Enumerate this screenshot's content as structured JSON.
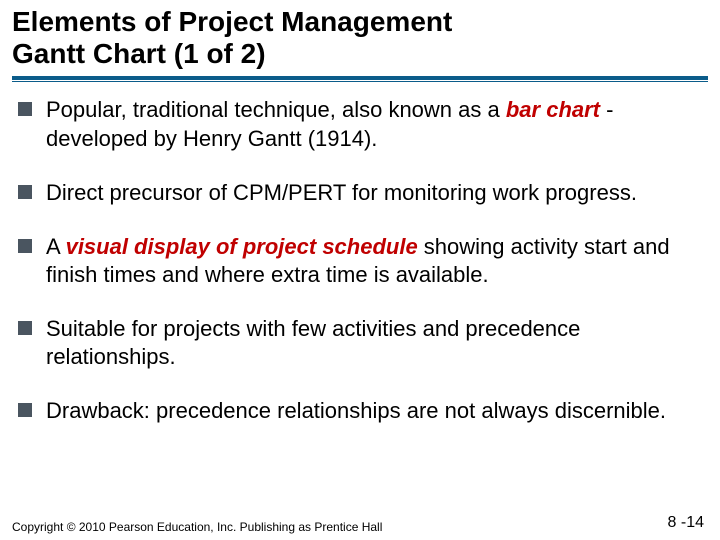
{
  "title": {
    "line1": "Elements of Project Management",
    "line2": "Gantt Chart  (1 of 2)"
  },
  "bullets": {
    "b1": {
      "pre": "Popular, traditional technique, also known as a ",
      "em": "bar chart",
      "post": "  - developed by Henry Gantt (1914)."
    },
    "b2": "Direct precursor of  CPM/PERT for monitoring work progress.",
    "b3": {
      "pre": "A ",
      "em": "visual display of project schedule",
      "post": " showing activity start and finish times and where extra time is available."
    },
    "b4": "Suitable for projects with few activities and precedence relationships.",
    "b5": "Drawback: precedence relationships are not always discernible."
  },
  "footer": {
    "lines": "Copyright © 2010 Pearson Education, Inc. Publishing as Prentice Hall"
  },
  "page": "8 -14"
}
